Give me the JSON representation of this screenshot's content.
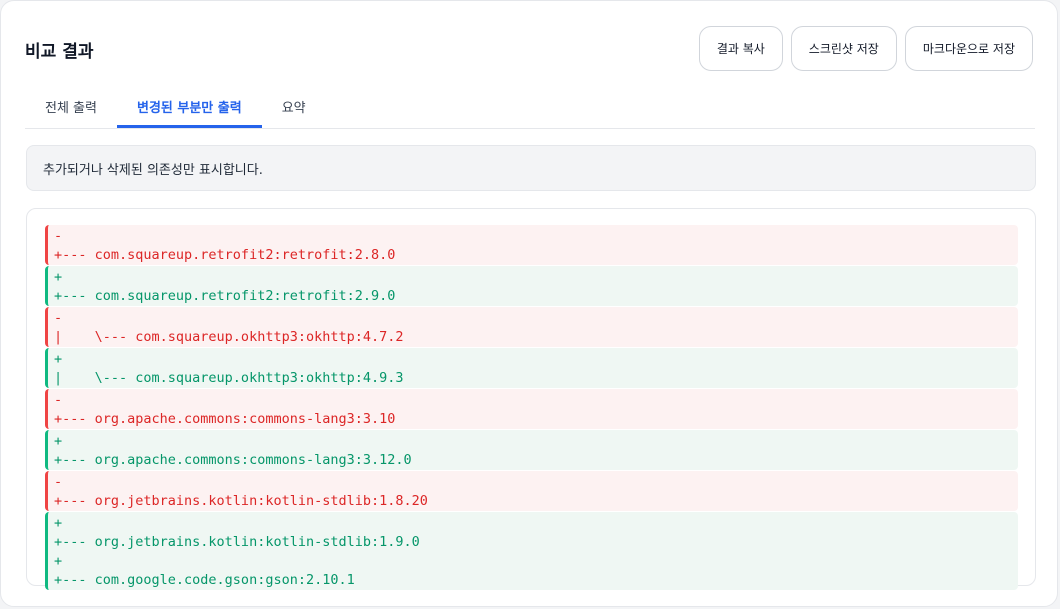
{
  "header": {
    "title": "비교 결과",
    "buttons": [
      "결과 복사",
      "스크린샷 저장",
      "마크다운으로 저장"
    ]
  },
  "tabs": [
    {
      "label": "전체 출력",
      "active": false
    },
    {
      "label": "변경된 부분만 출력",
      "active": true
    },
    {
      "label": "요약",
      "active": false
    }
  ],
  "notice": "추가되거나 삭제된 의존성만 표시합니다.",
  "colors": {
    "accent": "#2563eb",
    "removed_text": "#dc2626",
    "removed_bg": "#fdf2f2",
    "removed_border": "#ef4444",
    "added_text": "#059669",
    "added_bg": "#eff7f3",
    "added_border": "#10b981"
  },
  "diff": [
    {
      "type": "removed",
      "lines": [
        "-",
        "+--- com.squareup.retrofit2:retrofit:2.8.0"
      ]
    },
    {
      "type": "added",
      "lines": [
        "+",
        "+--- com.squareup.retrofit2:retrofit:2.9.0"
      ]
    },
    {
      "type": "removed",
      "lines": [
        "-",
        "|    \\--- com.squareup.okhttp3:okhttp:4.7.2"
      ]
    },
    {
      "type": "added",
      "lines": [
        "+",
        "|    \\--- com.squareup.okhttp3:okhttp:4.9.3"
      ]
    },
    {
      "type": "removed",
      "lines": [
        "-",
        "+--- org.apache.commons:commons-lang3:3.10"
      ]
    },
    {
      "type": "added",
      "lines": [
        "+",
        "+--- org.apache.commons:commons-lang3:3.12.0"
      ]
    },
    {
      "type": "removed",
      "lines": [
        "-",
        "+--- org.jetbrains.kotlin:kotlin-stdlib:1.8.20"
      ]
    },
    {
      "type": "added",
      "lines": [
        "+",
        "+--- org.jetbrains.kotlin:kotlin-stdlib:1.9.0",
        "+",
        "+--- com.google.code.gson:gson:2.10.1"
      ]
    }
  ]
}
